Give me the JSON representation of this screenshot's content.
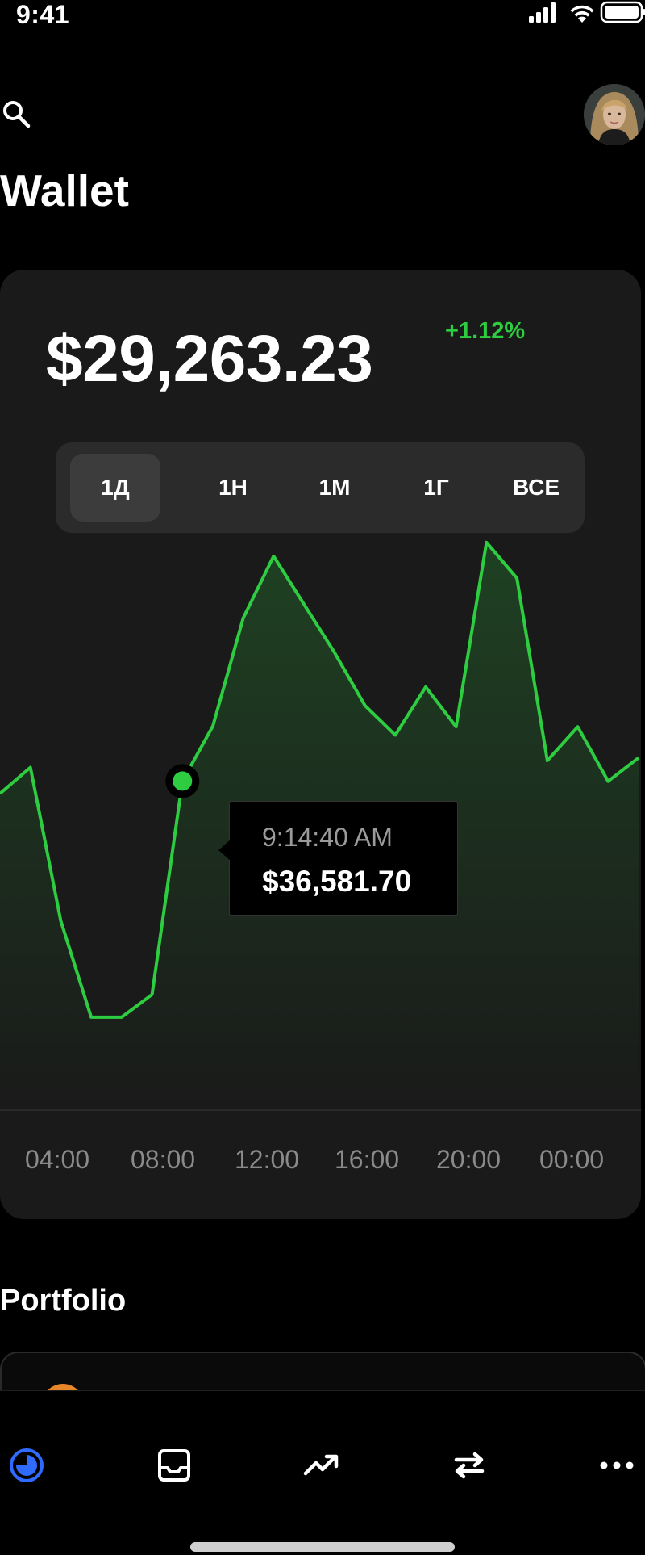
{
  "status_bar": {
    "time": "9:41",
    "icons": [
      "signal-icon",
      "wifi-icon",
      "battery-icon"
    ]
  },
  "header": {
    "title": "Wallet",
    "icons": [
      "search-icon",
      "avatar"
    ]
  },
  "balance": {
    "amount": "$29,263.23",
    "change": "+1.12%",
    "change_color": "#2ecc40"
  },
  "range_tabs": [
    {
      "label": "1Д",
      "active": true
    },
    {
      "label": "1Н",
      "active": false
    },
    {
      "label": "1М",
      "active": false
    },
    {
      "label": "1Г",
      "active": false
    },
    {
      "label": "ВСЕ",
      "active": false
    }
  ],
  "chart_data": {
    "type": "area",
    "line_color": "#2ecc40",
    "x_tick_labels": [
      "04:00",
      "08:00",
      "12:00",
      "16:00",
      "20:00",
      "00:00"
    ],
    "series": [
      {
        "values": [
          36400,
          36780,
          34550,
          33150,
          33150,
          33480,
          36581.7,
          37380,
          38950,
          39850,
          39150,
          38450,
          37680,
          37250,
          37950,
          37370,
          40050,
          39530,
          36880,
          37370,
          36580,
          36920
        ]
      }
    ],
    "ylim": [
      31800,
      42300
    ],
    "grid": false,
    "tooltip": {
      "time": "9:14:40 AM",
      "value": "$36,581.70",
      "point_index": 6
    }
  },
  "portfolio": {
    "title": "Portfolio"
  },
  "tab_bar": {
    "items": [
      {
        "icon": "portfolio-pie-icon",
        "active": true
      },
      {
        "icon": "inbox-icon",
        "active": false
      },
      {
        "icon": "trending-icon",
        "active": false
      },
      {
        "icon": "swap-icon",
        "active": false
      },
      {
        "icon": "more-icon",
        "active": false
      }
    ],
    "active_color": "#2f6bff"
  }
}
